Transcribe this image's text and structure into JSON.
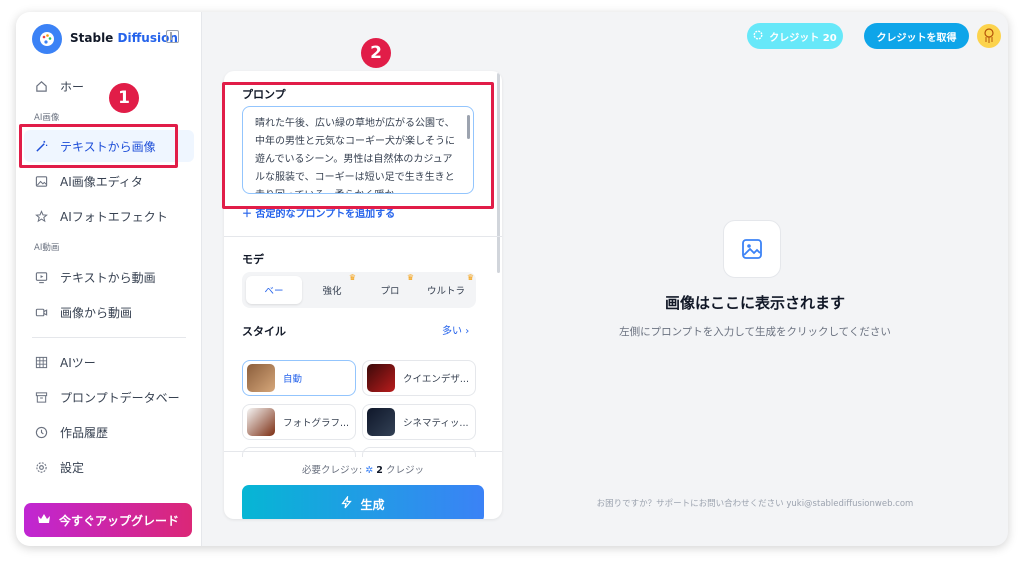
{
  "sidebar": {
    "brand_part1": "Stable",
    "brand_part2": "Diffusion",
    "home": "ホー",
    "section_image": "AI画像",
    "text_to_image": "テキストから画像",
    "image_editor": "AI画像エディタ",
    "photo_effect": "AIフォトエフェクト",
    "section_video": "AI動画",
    "text_to_video": "テキストから動画",
    "image_to_video": "画像から動画",
    "ai_tools": "AIツー",
    "prompt_db": "プロンプトデータベー",
    "history": "作品履歴",
    "settings": "設定",
    "upgrade": "今すぐアップグレード"
  },
  "annotations": {
    "badge1": "1",
    "badge2": "2"
  },
  "panel": {
    "prompt_label": "プロンプ",
    "prompt_text": "晴れた午後、広い緑の草地が広がる公園で、中年の男性と元気なコーギー犬が楽しそうに遊んでいるシーン。男性は自然体のカジュアルな服装で、コーギーは短い足で生き生きと走り回っている。柔らかく暖か",
    "negative_link": "＋ 否定的なプロンプトを追加する",
    "mode_label": "モデ",
    "modes": [
      "ベー",
      "強化",
      "プロ",
      "ウルトラ"
    ],
    "style_label": "スタイル",
    "more": "多い",
    "styles": [
      "自動",
      "クイエンデザ...",
      "フォトグラフ...",
      "シネマティッ..."
    ],
    "required_credits_label": "必要クレジッ:",
    "required_credits_value": "2",
    "required_credits_unit": "クレジッ",
    "generate": "生成"
  },
  "topbar": {
    "credits": "クレジット 20",
    "get_credits": "クレジットを取得"
  },
  "preview": {
    "title": "画像はここに表示されます",
    "subtitle": "左側にプロンプトを入力して生成をクリックしてください",
    "support": "お困りですか？サポートにお問い合わせください yuki@stablediffusionweb.com"
  },
  "colors": {
    "accent": "#2563eb",
    "highlight": "#e11d48",
    "upgrade_start": "#c026d3",
    "upgrade_end": "#db2777",
    "generate_start": "#06b6d4",
    "generate_end": "#3b82f6"
  }
}
